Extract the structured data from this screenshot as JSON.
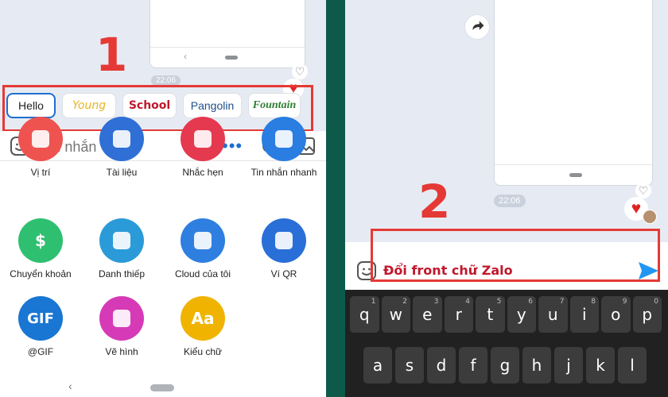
{
  "left": {
    "step_number": "1",
    "time": "22:06",
    "fonts": [
      {
        "label": "Hello",
        "color": "#222222",
        "family": "\"Liberation Sans\", sans-serif",
        "style": "normal",
        "weight": "normal",
        "selected": true
      },
      {
        "label": "Young",
        "color": "#e8b425",
        "family": "\"DejaVu Sans\", sans-serif",
        "style": "italic",
        "weight": "normal",
        "selected": false
      },
      {
        "label": "School",
        "color": "#c0182b",
        "family": "\"DejaVu Sans\", sans-serif",
        "style": "normal",
        "weight": "bold",
        "selected": false
      },
      {
        "label": "Pangolin",
        "color": "#1e4f8a",
        "family": "\"Liberation Sans\", sans-serif",
        "style": "normal",
        "weight": "normal",
        "selected": false
      },
      {
        "label": "Fountain",
        "color": "#2e7d32",
        "family": "\"Liberation Serif\", serif",
        "style": "italic",
        "weight": "bold",
        "selected": false
      }
    ],
    "input_placeholder": "Tin nhắn",
    "tiles": [
      {
        "label": "Vị trí",
        "color": "#ef5350",
        "glyph": "",
        "cut": true
      },
      {
        "label": "Tài liệu",
        "color": "#2f6fd6",
        "glyph": "",
        "cut": true
      },
      {
        "label": "Nhắc hẹn",
        "color": "#e53950",
        "glyph": "",
        "cut": true
      },
      {
        "label": "Tin nhắn nhanh",
        "color": "#2a7de1",
        "glyph": "",
        "cut": true
      },
      {
        "label": "Chuyển khoản",
        "color": "#2fbf71",
        "glyph": "$",
        "cut": false
      },
      {
        "label": "Danh thiếp",
        "color": "#2a9bd8",
        "glyph": "",
        "cut": false
      },
      {
        "label": "Cloud của tôi",
        "color": "#2f7fe0",
        "glyph": "",
        "cut": false
      },
      {
        "label": "Ví QR",
        "color": "#2a6fd8",
        "glyph": "",
        "cut": false
      },
      {
        "label": "@GIF",
        "color": "#1976d2",
        "glyph": "GIF",
        "cut": false
      },
      {
        "label": "Vẽ hình",
        "color": "#d63ab6",
        "glyph": "",
        "cut": false
      },
      {
        "label": "Kiểu chữ",
        "color": "#f0b400",
        "glyph": "Aa",
        "cut": false
      }
    ]
  },
  "right": {
    "step_number": "2",
    "time": "22:06",
    "input_value": "Đổi front chữ Zalo",
    "keyboard": {
      "row1": [
        {
          "k": "q",
          "h": "1"
        },
        {
          "k": "w",
          "h": "2"
        },
        {
          "k": "e",
          "h": "3"
        },
        {
          "k": "r",
          "h": "4"
        },
        {
          "k": "t",
          "h": "5"
        },
        {
          "k": "y",
          "h": "6"
        },
        {
          "k": "u",
          "h": "7"
        },
        {
          "k": "i",
          "h": "8"
        },
        {
          "k": "o",
          "h": "9"
        },
        {
          "k": "p",
          "h": "0"
        }
      ],
      "row2": [
        {
          "k": "a",
          "h": ""
        },
        {
          "k": "s",
          "h": ""
        },
        {
          "k": "d",
          "h": ""
        },
        {
          "k": "f",
          "h": ""
        },
        {
          "k": "g",
          "h": ""
        },
        {
          "k": "h",
          "h": ""
        },
        {
          "k": "j",
          "h": ""
        },
        {
          "k": "k",
          "h": ""
        },
        {
          "k": "l",
          "h": ""
        }
      ]
    }
  },
  "colors": {
    "accent_blue": "#1e6fd0",
    "highlight_red": "#e53935",
    "send_blue": "#2196f3"
  }
}
